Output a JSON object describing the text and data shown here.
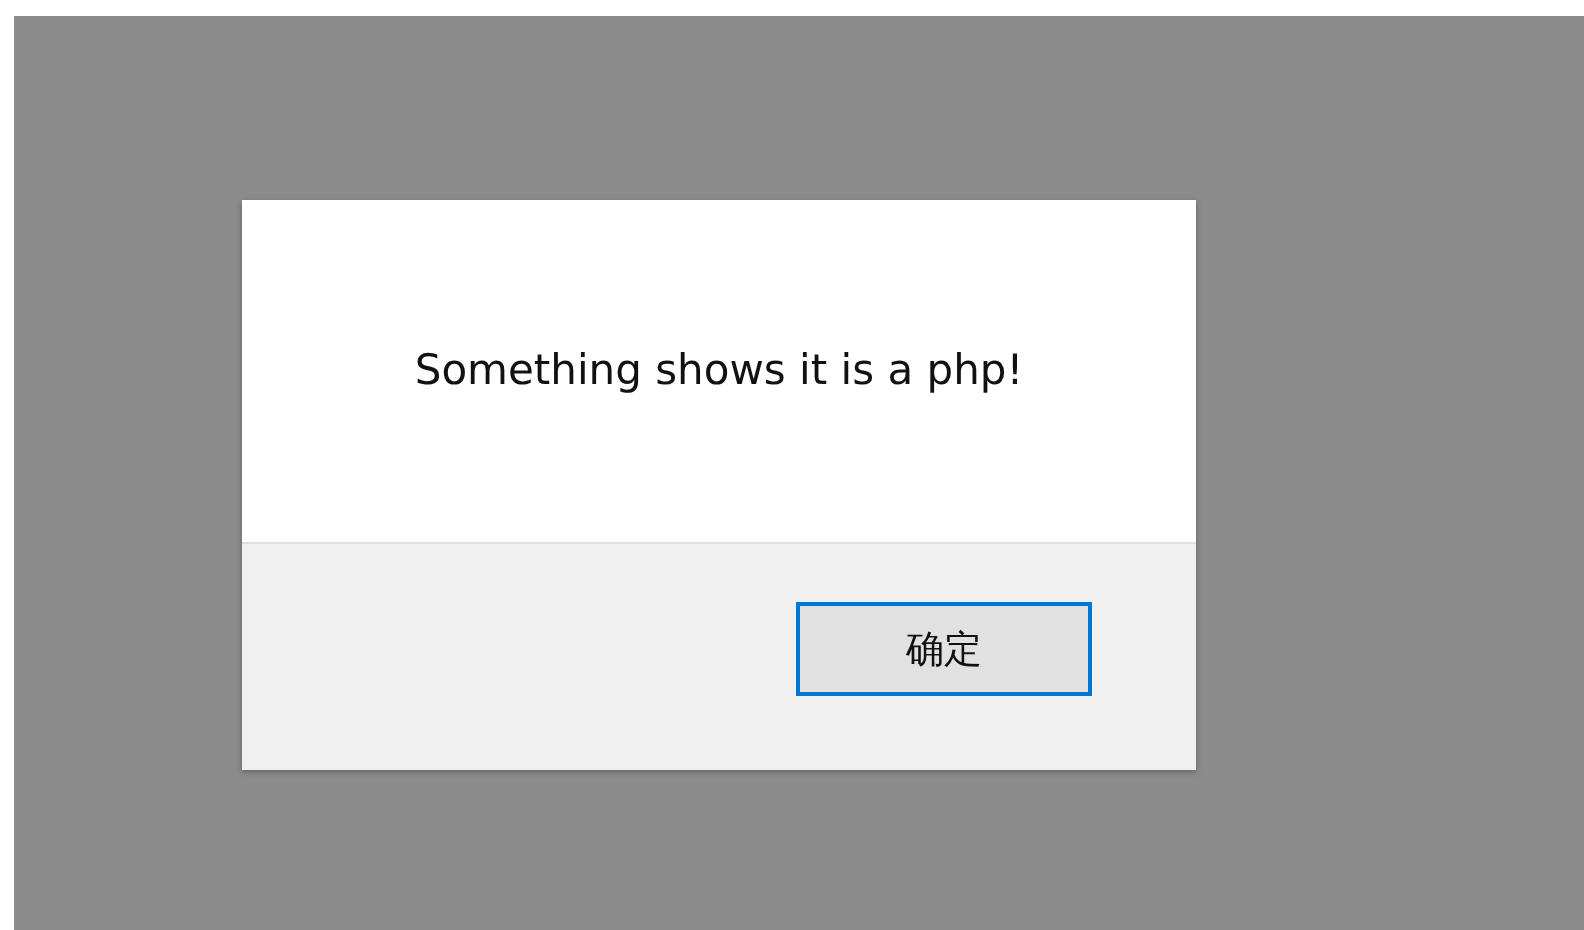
{
  "dialog": {
    "message": "Something shows it is a php!",
    "buttons": [
      {
        "label": "确定",
        "focused": true
      }
    ]
  }
}
